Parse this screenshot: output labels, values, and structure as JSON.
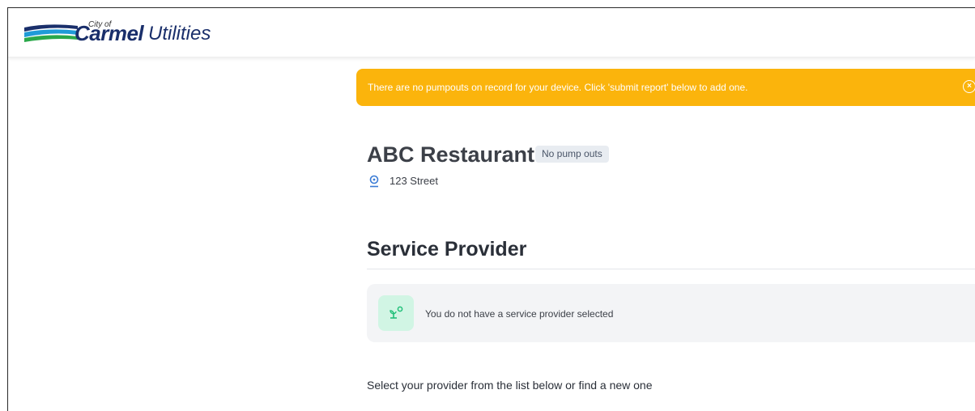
{
  "header": {
    "logo_city_of": "City of",
    "logo_carmel": "Carmel",
    "logo_utilities": "Utilities"
  },
  "alert": {
    "message": "There are no pumpouts on record for your device. Click 'submit report' below to add one.",
    "close_icon": "close-circle-icon",
    "color": "#fbb40c"
  },
  "facility": {
    "name": "ABC Restaurant",
    "status_badge": "No pump outs",
    "address": "123 Street",
    "address_icon": "location-pin-icon"
  },
  "service_provider": {
    "section_title": "Service Provider",
    "empty_message": "You do not have a service provider selected",
    "empty_icon": "provider-sprout-icon",
    "icon_bg_color": "#d1f5e4",
    "icon_color": "#22c07a"
  },
  "footer_prompt": {
    "text": "Select your provider from the list below or find a new one"
  }
}
